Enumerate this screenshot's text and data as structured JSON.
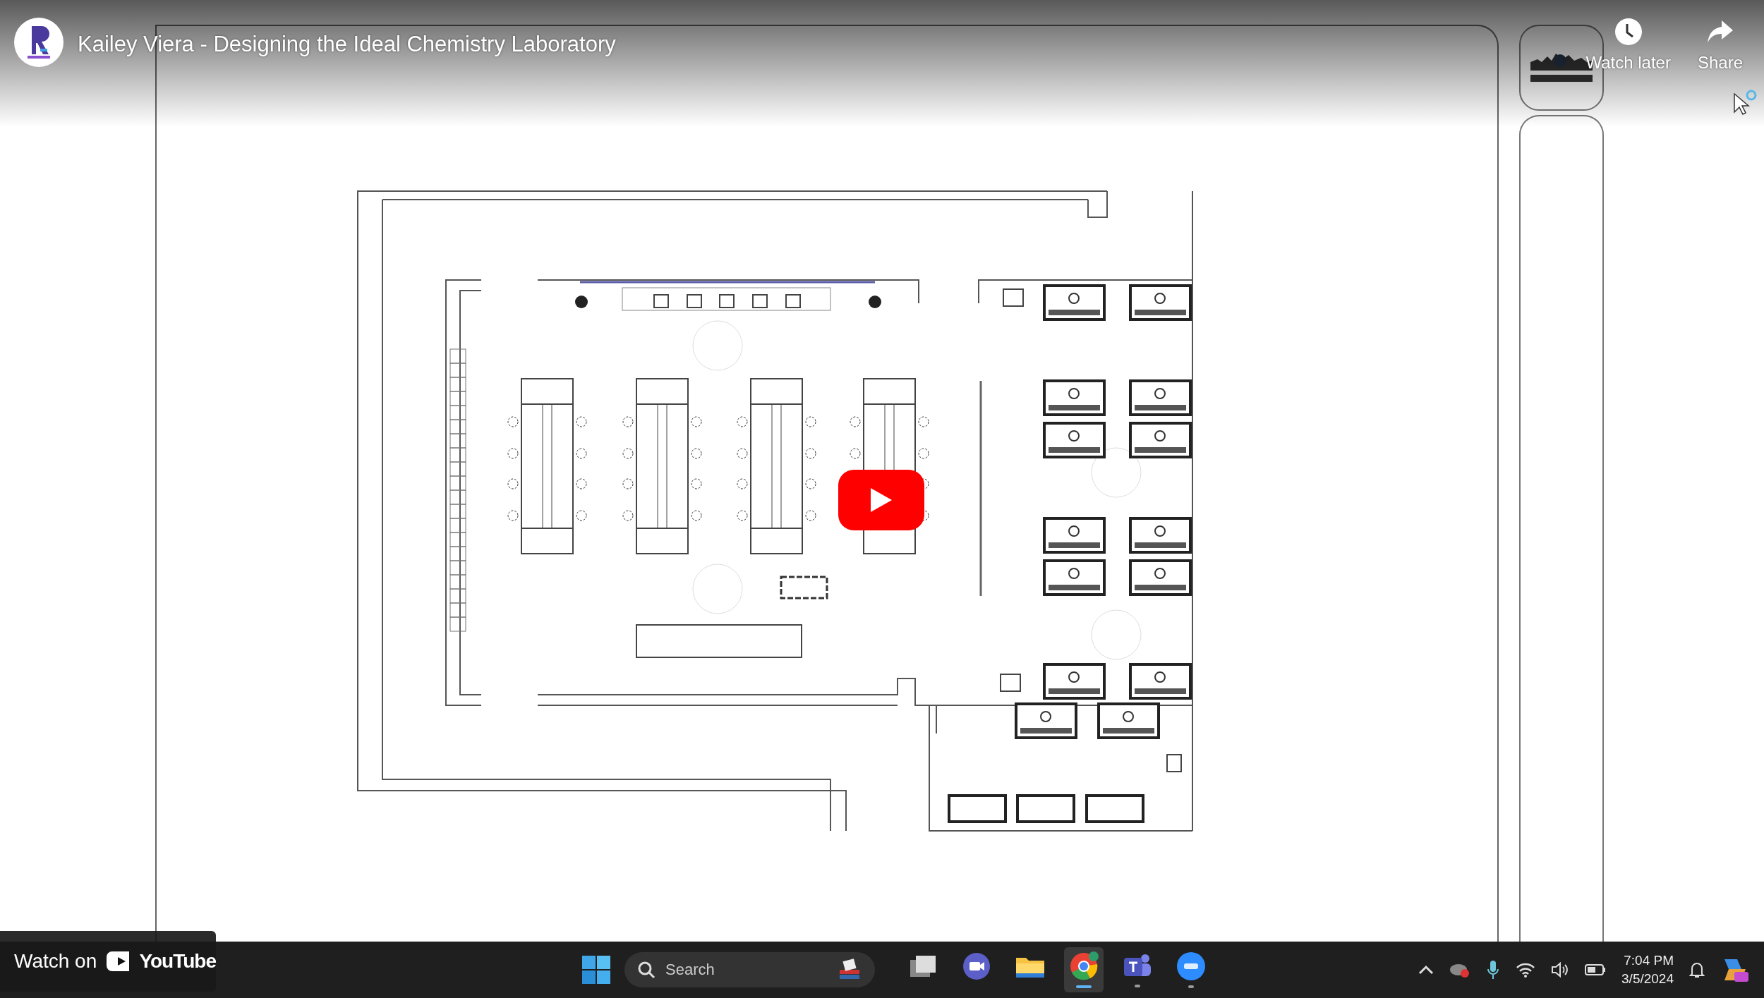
{
  "video": {
    "title": "Kailey Viera - Designing the Ideal Chemistry Laboratory",
    "actions": [
      {
        "kind": "clock",
        "label": "Watch later"
      },
      {
        "kind": "share",
        "label": "Share"
      }
    ],
    "watch_on": {
      "label": "Watch on",
      "brand": "YouTube"
    }
  },
  "taskbar": {
    "search": {
      "placeholder": "Search"
    },
    "apps": [
      {
        "kind": "files-stack",
        "running": false,
        "selected": false
      },
      {
        "kind": "video-call",
        "running": false,
        "selected": false
      },
      {
        "kind": "folder",
        "running": false,
        "selected": false
      },
      {
        "kind": "browser",
        "running": true,
        "selected": true
      },
      {
        "kind": "team-chat",
        "running": true,
        "selected": false
      },
      {
        "kind": "meeting",
        "running": true,
        "selected": false
      }
    ],
    "clock": {
      "time": "7:04 PM",
      "date": "3/5/2024"
    }
  }
}
